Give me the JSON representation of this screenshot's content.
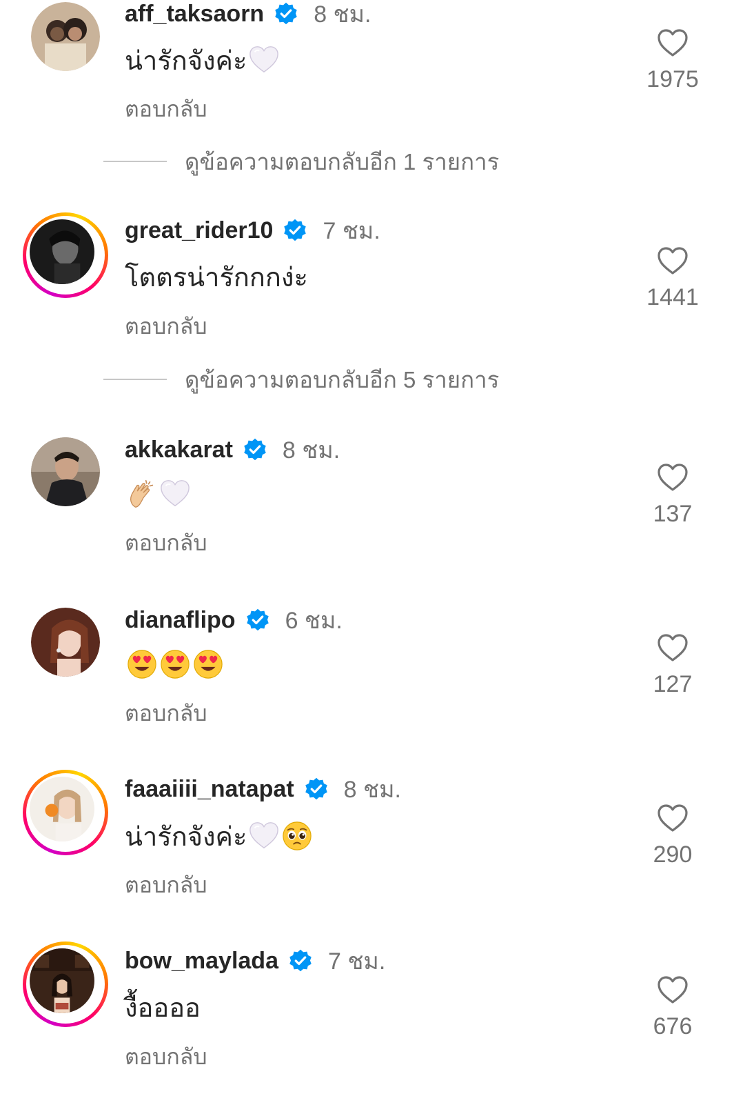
{
  "colors": {
    "text_primary": "#262626",
    "text_secondary": "#737373",
    "verified_blue": "#0095f6",
    "divider": "#c7c7c7"
  },
  "comments": [
    {
      "username": "aff_taksaorn",
      "verified": true,
      "time": "8 ชม.",
      "text": "น่ารักจังค่ะ",
      "emojis": [
        "white-heart"
      ],
      "reply_label": "ตอบกลับ",
      "likes": "1975",
      "story_ring": false,
      "view_replies": "ดูข้อความตอบกลับอีก 1 รายการ"
    },
    {
      "username": "great_rider10",
      "verified": true,
      "time": "7 ชม.",
      "text": "โตตรน่ารักกกง่ะ",
      "emojis": [],
      "reply_label": "ตอบกลับ",
      "likes": "1441",
      "story_ring": true,
      "view_replies": "ดูข้อความตอบกลับอีก 5 รายการ"
    },
    {
      "username": "akkakarat",
      "verified": true,
      "time": "8 ชม.",
      "text": "",
      "emojis": [
        "clapping-hands",
        "white-heart"
      ],
      "reply_label": "ตอบกลับ",
      "likes": "137",
      "story_ring": false
    },
    {
      "username": "dianaflipo",
      "verified": true,
      "time": "6 ชม.",
      "text": "",
      "emojis": [
        "heart-eyes",
        "heart-eyes",
        "heart-eyes"
      ],
      "reply_label": "ตอบกลับ",
      "likes": "127",
      "story_ring": false
    },
    {
      "username": "faaaiiii_natapat",
      "verified": true,
      "time": "8 ชม.",
      "text": "น่ารักจังค่ะ",
      "emojis": [
        "white-heart",
        "pleading-face"
      ],
      "reply_label": "ตอบกลับ",
      "likes": "290",
      "story_ring": true
    },
    {
      "username": "bow_maylada",
      "verified": true,
      "time": "7 ชม.",
      "text": "งื้ออออ",
      "emojis": [],
      "reply_label": "ตอบกลับ",
      "likes": "676",
      "story_ring": true
    }
  ]
}
